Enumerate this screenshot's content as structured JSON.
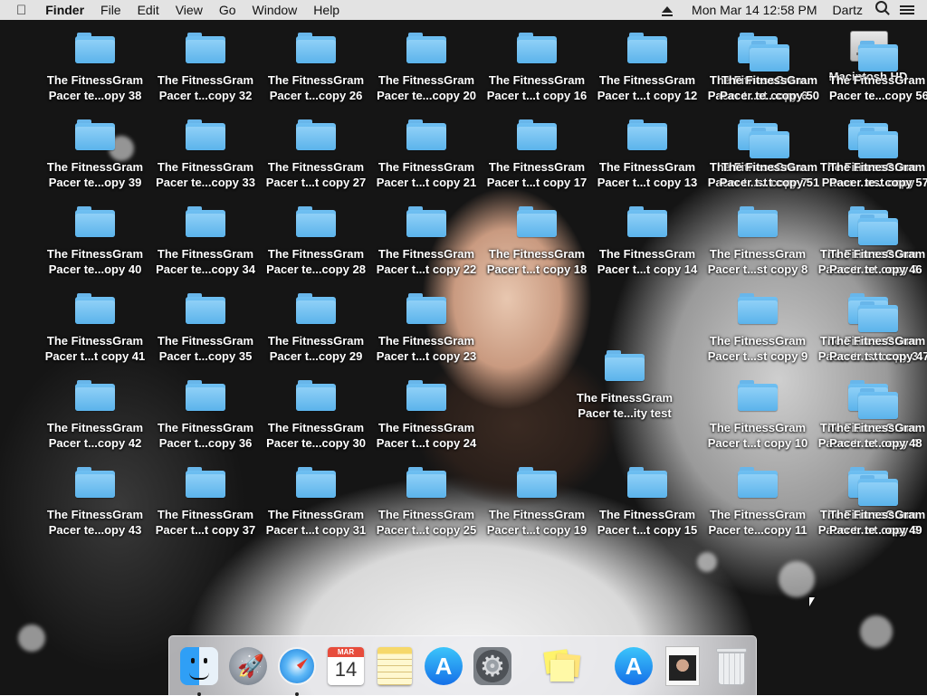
{
  "menubar": {
    "apple_icon": "apple-logo",
    "app_name": "Finder",
    "menus": [
      "File",
      "Edit",
      "View",
      "Go",
      "Window",
      "Help"
    ],
    "clock": "Mon Mar 14  12:58 PM",
    "user": "Dartz"
  },
  "desktop": {
    "hd_label": "Macintosh HD",
    "icons": [
      {
        "l1": "The FitnessGram",
        "l2": "Pacer te...opy 38"
      },
      {
        "l1": "The FitnessGram",
        "l2": "Pacer t...copy 32"
      },
      {
        "l1": "The FitnessGram",
        "l2": "Pacer t...copy 26"
      },
      {
        "l1": "The FitnessGram",
        "l2": "Pacer te...copy 20"
      },
      {
        "l1": "The FitnessGram",
        "l2": "Pacer t...t copy 16"
      },
      {
        "l1": "The FitnessGram",
        "l2": "Pacer t...t copy 12"
      },
      {
        "l1": "The FitnessGram",
        "l2": "Pacer t...st copy 6"
      },
      {
        "l1": "The FitnessGram",
        "l2": "Pacer te...opy 39"
      },
      {
        "l1": "The FitnessGram",
        "l2": "Pacer te...copy 33"
      },
      {
        "l1": "The FitnessGram",
        "l2": "Pacer t...t copy 27"
      },
      {
        "l1": "The FitnessGram",
        "l2": "Pacer t...t copy 21"
      },
      {
        "l1": "The FitnessGram",
        "l2": "Pacer t...t copy 17"
      },
      {
        "l1": "The FitnessGram",
        "l2": "Pacer t...t copy 13"
      },
      {
        "l1": "The FitnessGram",
        "l2": "Pacer t...st copy 7"
      },
      {
        "l1": "The FitnessGram",
        "l2": "Pacer ...est copy"
      },
      {
        "l1": "The FitnessGram",
        "l2": "Pacer te...opy 40"
      },
      {
        "l1": "The FitnessGram",
        "l2": "Pacer te...copy 34"
      },
      {
        "l1": "The FitnessGram",
        "l2": "Pacer te...copy 28"
      },
      {
        "l1": "The FitnessGram",
        "l2": "Pacer t...t copy 22"
      },
      {
        "l1": "The FitnessGram",
        "l2": "Pacer t...t copy 18"
      },
      {
        "l1": "The FitnessGram",
        "l2": "Pacer t...t copy 14"
      },
      {
        "l1": "The FitnessGram",
        "l2": "Pacer t...st copy 8"
      },
      {
        "l1": "The FitnessGram",
        "l2": "Pacer t...st copy 2"
      },
      {
        "l1": "The FitnessGram",
        "l2": "Pacer t...t copy 41"
      },
      {
        "l1": "The FitnessGram",
        "l2": "Pacer t...copy 35"
      },
      {
        "l1": "The FitnessGram",
        "l2": "Pacer t...copy 29"
      },
      {
        "l1": "The FitnessGram",
        "l2": "Pacer t...t copy 23"
      },
      {
        "l1": "The FitnessGram",
        "l2": "Pacer t...st copy 9"
      },
      {
        "l1": "The FitnessGram",
        "l2": "Pacer t...st copy 3"
      },
      {
        "l1": "The FitnessGram",
        "l2": "Pacer te...ity test"
      },
      {
        "l1": "The FitnessGram",
        "l2": "Pacer t...copy 42"
      },
      {
        "l1": "The FitnessGram",
        "l2": "Pacer t...copy 36"
      },
      {
        "l1": "The FitnessGram",
        "l2": "Pacer te...copy 30"
      },
      {
        "l1": "The FitnessGram",
        "l2": "Pacer t...t copy 24"
      },
      {
        "l1": "The FitnessGram",
        "l2": "Pacer t...t copy 10"
      },
      {
        "l1": "The FitnessGram",
        "l2": "Pacer t...st copy 4"
      },
      {
        "l1": "The FitnessGram",
        "l2": "Pacer te...opy 43"
      },
      {
        "l1": "The FitnessGram",
        "l2": "Pacer t...t copy 37"
      },
      {
        "l1": "The FitnessGram",
        "l2": "Pacer t...t copy 31"
      },
      {
        "l1": "The FitnessGram",
        "l2": "Pacer t...t copy 25"
      },
      {
        "l1": "The FitnessGram",
        "l2": "Pacer t...t copy 19"
      },
      {
        "l1": "The FitnessGram",
        "l2": "Pacer t...t copy 15"
      },
      {
        "l1": "The FitnessGram",
        "l2": "Pacer te...copy 11"
      },
      {
        "l1": "The FitnessGram",
        "l2": "Pacer t...st copy 5"
      },
      {
        "l1": "The FitnessGram",
        "l2": "Pacer te...copy 50"
      },
      {
        "l1": "The FitnessGram",
        "l2": "Pacer te...copy 56"
      },
      {
        "l1": "The FitnessGram",
        "l2": "Pacer t...t copy 51"
      },
      {
        "l1": "The FitnessGram",
        "l2": "Pacer te...copy 57"
      },
      {
        "l1": "The FitnessGram",
        "l2": "Pacer te...opy 46"
      },
      {
        "l1": "The FitnessGram",
        "l2": "Pacer t...t copy 47"
      },
      {
        "l1": "The FitnessGram",
        "l2": "Pacer te...opy 48"
      },
      {
        "l1": "The FitnessGram",
        "l2": "Pacer te...opy 49"
      }
    ]
  },
  "dock": {
    "calendar_month": "MAR",
    "calendar_day": "14",
    "items": [
      "finder-icon",
      "launchpad-icon",
      "safari-icon",
      "calendar-icon",
      "notes-icon",
      "app-store-icon",
      "system-preferences-icon",
      "stickies-icon",
      "app-store-download-icon",
      "image-document-icon",
      "trash-icon"
    ]
  },
  "colors": {
    "folder": "#5bb3eb",
    "menubar": "#ececec"
  }
}
